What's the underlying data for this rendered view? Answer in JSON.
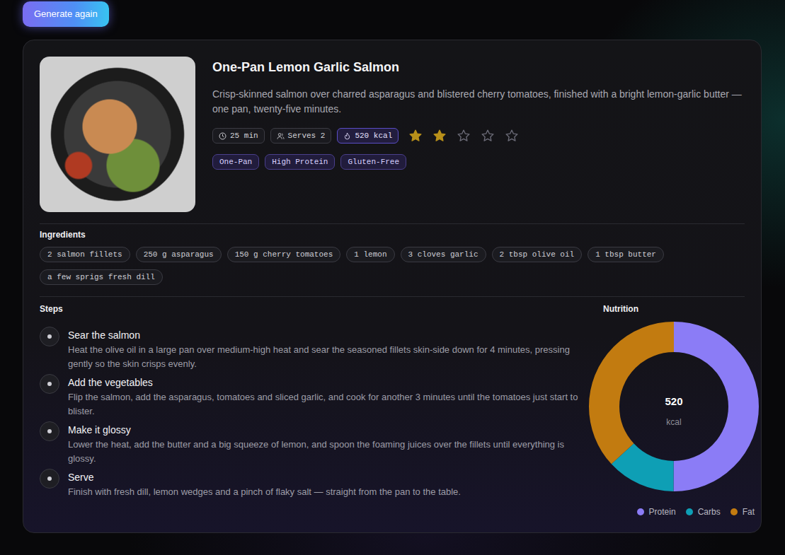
{
  "toolbar": {
    "generate_button": "Generate again"
  },
  "recipe": {
    "title": "One-Pan Lemon Garlic Salmon",
    "description": "Crisp-skinned salmon over charred asparagus and blistered cherry tomatoes, finished with a bright lemon-garlic butter — one pan, twenty-five minutes.",
    "meta": [
      {
        "kind": "time",
        "text": "25 min",
        "highlighted": false
      },
      {
        "kind": "servings",
        "text": "Serves 2",
        "highlighted": false
      },
      {
        "kind": "calories",
        "text": "520 kcal",
        "highlighted": true
      }
    ],
    "rating": {
      "stars": 2,
      "max": 5
    },
    "tags": [
      "One-Pan",
      "High Protein",
      "Gluten-Free"
    ]
  },
  "ingredients": {
    "heading": "Ingredients",
    "items": [
      "2 salmon fillets",
      "250 g asparagus",
      "150 g cherry tomatoes",
      "1 lemon",
      "3 cloves garlic",
      "2 tbsp olive oil",
      "1 tbsp butter",
      "a few sprigs fresh dill"
    ]
  },
  "steps": {
    "heading": "Steps",
    "items": [
      {
        "title": "Sear the salmon",
        "text": "Heat the olive oil in a large pan over medium-high heat and sear the seasoned fillets skin-side down for 4 minutes, pressing gently so the skin crisps evenly."
      },
      {
        "title": "Add the vegetables",
        "text": "Flip the salmon, add the asparagus, tomatoes and sliced garlic, and cook for another 3 minutes until the tomatoes just start to blister."
      },
      {
        "title": "Make it glossy",
        "text": "Lower the heat, add the butter and a big squeeze of lemon, and spoon the foaming juices over the fillets until everything is glossy."
      },
      {
        "title": "Serve",
        "text": "Finish with fresh dill, lemon wedges and a pinch of flaky salt — straight from the pan to the table."
      }
    ]
  },
  "nutrition": {
    "heading": "Nutrition",
    "center_value": "520",
    "center_unit": "kcal",
    "series": [
      {
        "label": "Protein",
        "value": 46,
        "color": "#8b7cf6"
      },
      {
        "label": "Carbs",
        "value": 12,
        "color": "#0e9fb5"
      },
      {
        "label": "Fat",
        "value": 34,
        "color": "#c27b10"
      }
    ]
  }
}
